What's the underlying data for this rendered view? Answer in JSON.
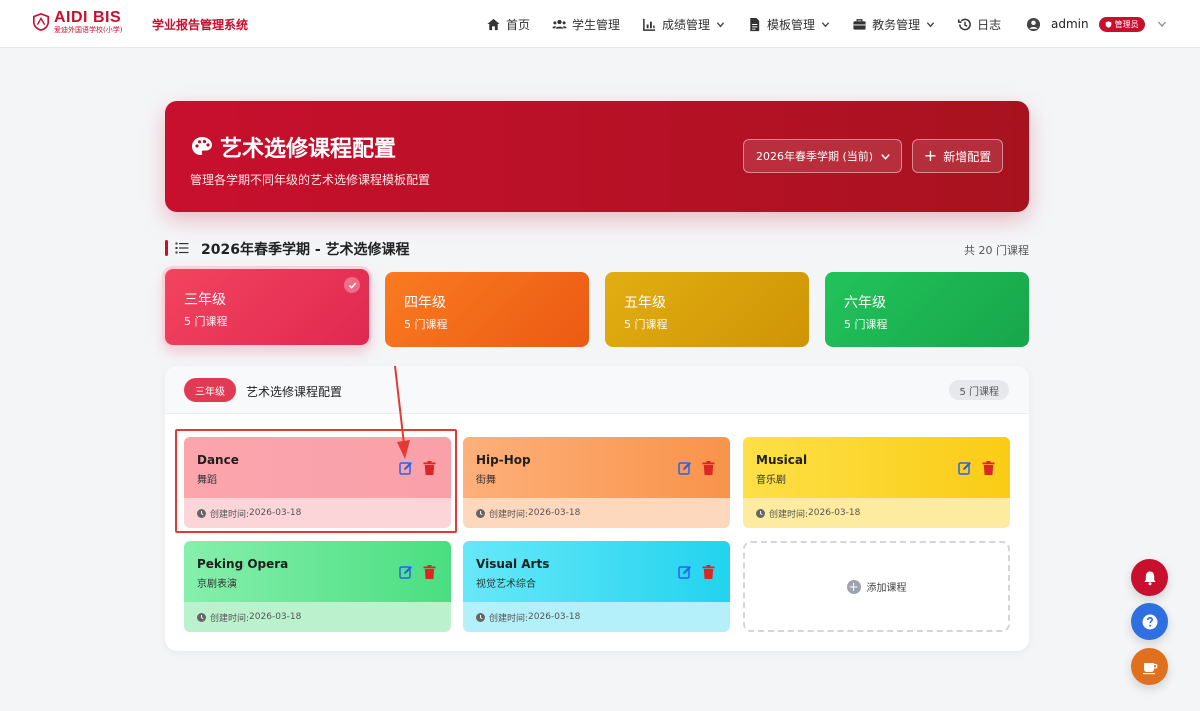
{
  "header": {
    "logo_name": "AIDI BIS",
    "logo_sub": "爱迪外国语学校(小学)",
    "system_title": "学业报告管理系统",
    "nav": [
      {
        "label": "首页",
        "icon": "home-icon"
      },
      {
        "label": "学生管理",
        "icon": "users-icon"
      },
      {
        "label": "成绩管理",
        "icon": "chart-icon"
      },
      {
        "label": "模板管理",
        "icon": "file-icon"
      },
      {
        "label": "教务管理",
        "icon": "briefcase-icon"
      },
      {
        "label": "日志",
        "icon": "history-icon"
      }
    ],
    "user_name": "admin",
    "role_badge": "管理员"
  },
  "hero": {
    "title": "艺术选修课程配置",
    "subtitle": "管理各学期不同年级的艺术选修课程模板配置",
    "semester_selected": "2026年春季学期 (当前)",
    "add_button": "新增配置"
  },
  "section": {
    "title": "2026年春季学期 - 艺术选修课程",
    "total": "共 20 门课程"
  },
  "grades": [
    {
      "name": "三年级",
      "count": "5 门课程",
      "selected": true
    },
    {
      "name": "四年级",
      "count": "5 门课程",
      "selected": false
    },
    {
      "name": "五年级",
      "count": "5 门课程",
      "selected": false
    },
    {
      "name": "六年级",
      "count": "5 门课程",
      "selected": false
    }
  ],
  "panel": {
    "grade_pill": "三年级",
    "title": "艺术选修课程配置",
    "count": "5 门课程",
    "created_prefix": "创建时间:",
    "courses": [
      {
        "name": "Dance",
        "cn": "舞蹈",
        "created": "2026-03-18"
      },
      {
        "name": "Hip-Hop",
        "cn": "街舞",
        "created": "2026-03-18"
      },
      {
        "name": "Musical",
        "cn": "音乐剧",
        "created": "2026-03-18"
      },
      {
        "name": "Peking Opera",
        "cn": "京剧表演",
        "created": "2026-03-18"
      },
      {
        "name": "Visual Arts",
        "cn": "视觉艺术综合",
        "created": "2026-03-18"
      }
    ],
    "add_course": "添加课程"
  },
  "colors": {
    "brand": "#c8102e",
    "edit": "#2563eb",
    "delete": "#dc2626",
    "annotation": "#e53935"
  }
}
